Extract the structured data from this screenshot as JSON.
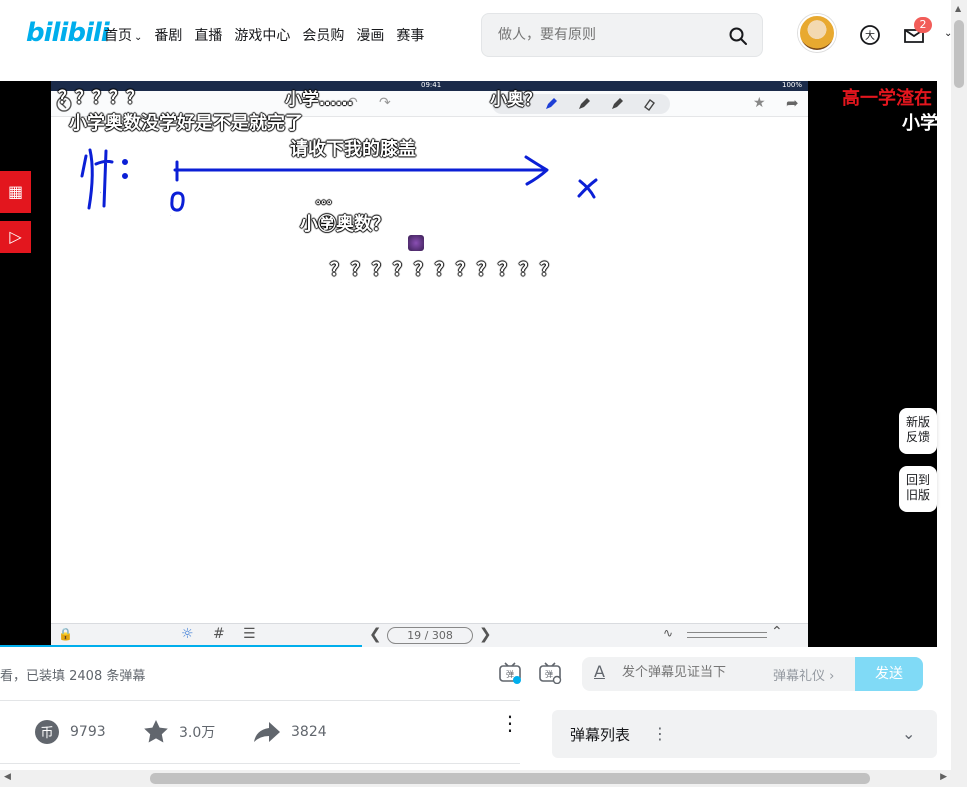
{
  "header": {
    "logo": "bilibili",
    "nav": [
      "首页",
      "番剧",
      "直播",
      "游戏中心",
      "会员购",
      "漫画",
      "赛事"
    ],
    "search_placeholder": "做人，要有原则",
    "message_badge": "2"
  },
  "player": {
    "status_time": "09:41",
    "status_battery": "100%",
    "page_indicator": "19 / 308",
    "danmaku": [
      "？？？？？",
      "小学……",
      "小奥？",
      "高一学渣在",
      "小学",
      "小学奥数没学好是不是就完了",
      "请收下我的膝盖",
      "小㊫奥数？",
      "？？？？？？？？？？？",
      "。。。"
    ],
    "handwriting": {
      "example_label": "例：",
      "origin_label": "0",
      "axis_label": "x"
    }
  },
  "float_buttons": {
    "new_feedback": [
      "新版",
      "反馈"
    ],
    "back_old": [
      "回到",
      "旧版"
    ]
  },
  "sendbar": {
    "watch_info": "看，已装填 2408 条弹幕",
    "input_placeholder": "发个弹幕见证当下",
    "etiquette": "弹幕礼仪",
    "send_label": "发送"
  },
  "actions": {
    "coin_count": "9793",
    "favorite_count": "3.0万",
    "share_count": "3824"
  },
  "danmaku_list": {
    "label": "弹幕列表"
  },
  "colors": {
    "brand": "#00aeec",
    "danger": "#e3161e",
    "send": "#80daf6",
    "ink": "#0b1fd6"
  }
}
